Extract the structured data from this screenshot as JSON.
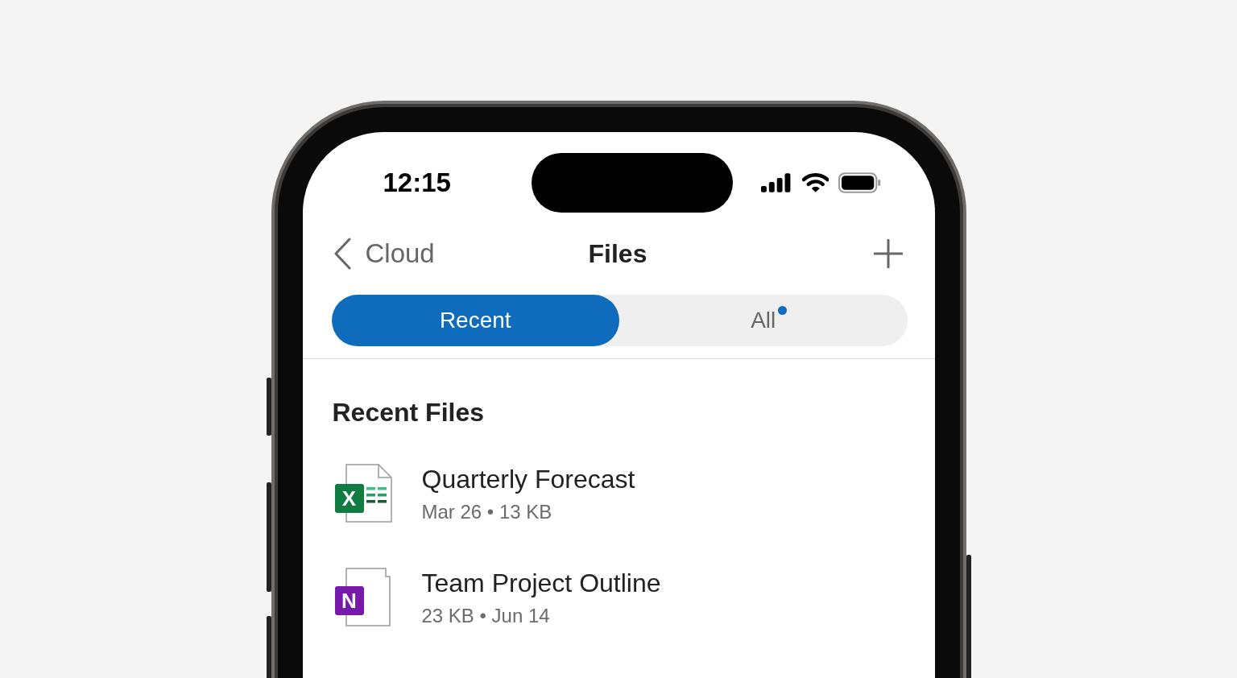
{
  "status_bar": {
    "time": "12:15"
  },
  "nav_bar": {
    "back_label": "Cloud",
    "title": "Files"
  },
  "tabs": [
    {
      "label": "Recent",
      "selected": true,
      "has_dot": false
    },
    {
      "label": "All",
      "selected": false,
      "has_dot": true
    }
  ],
  "section_title": "Recent Files",
  "files": [
    {
      "kind": "excel",
      "badge_letter": "X",
      "name": "Quarterly Forecast",
      "meta": "Mar 26 • 13 KB"
    },
    {
      "kind": "onenote",
      "badge_letter": "N",
      "name": "Team Project Outline",
      "meta": "23 KB • Jun 14"
    }
  ]
}
